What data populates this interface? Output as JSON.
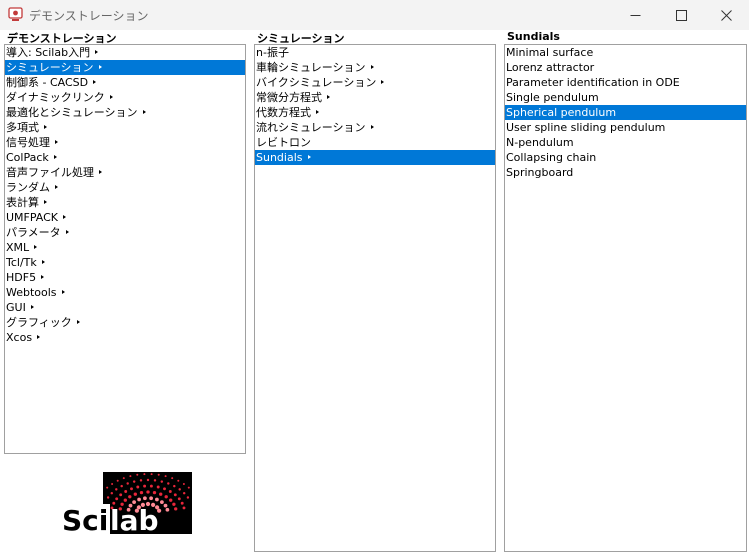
{
  "window": {
    "title": "デモンストレーション"
  },
  "columns": [
    {
      "title": "デモンストレーション",
      "items": [
        {
          "label": "導入: Scilab入門",
          "submenu": true
        },
        {
          "label": "シミュレーション",
          "submenu": true,
          "selected": true
        },
        {
          "label": "制御系 - CACSD",
          "submenu": true
        },
        {
          "label": "ダイナミックリンク",
          "submenu": true
        },
        {
          "label": "最適化とシミュレーション",
          "submenu": true
        },
        {
          "label": "多項式",
          "submenu": true
        },
        {
          "label": "信号処理",
          "submenu": true
        },
        {
          "label": "ColPack",
          "submenu": true
        },
        {
          "label": "音声ファイル処理",
          "submenu": true
        },
        {
          "label": "ランダム",
          "submenu": true
        },
        {
          "label": "表計算",
          "submenu": true
        },
        {
          "label": "UMFPACK",
          "submenu": true
        },
        {
          "label": "パラメータ",
          "submenu": true
        },
        {
          "label": "XML",
          "submenu": true
        },
        {
          "label": "Tcl/Tk",
          "submenu": true
        },
        {
          "label": "HDF5",
          "submenu": true
        },
        {
          "label": "Webtools",
          "submenu": true
        },
        {
          "label": "GUI",
          "submenu": true
        },
        {
          "label": "グラフィック",
          "submenu": true
        },
        {
          "label": "Xcos",
          "submenu": true
        }
      ]
    },
    {
      "title": "シミュレーション",
      "items": [
        {
          "label": "n-振子",
          "submenu": false
        },
        {
          "label": "車輪シミュレーション",
          "submenu": true
        },
        {
          "label": "バイクシミュレーション",
          "submenu": true
        },
        {
          "label": "常微分方程式",
          "submenu": true
        },
        {
          "label": "代数方程式",
          "submenu": true
        },
        {
          "label": "流れシミュレーション",
          "submenu": true
        },
        {
          "label": "レビトロン",
          "submenu": false
        },
        {
          "label": "Sundials",
          "submenu": true,
          "selected": true
        }
      ]
    },
    {
      "title": "Sundials",
      "items": [
        {
          "label": "Minimal surface",
          "submenu": false
        },
        {
          "label": "Lorenz attractor",
          "submenu": false
        },
        {
          "label": "Parameter identification in ODE",
          "submenu": false
        },
        {
          "label": "Single pendulum",
          "submenu": false
        },
        {
          "label": "Spherical pendulum",
          "submenu": false,
          "selected": true
        },
        {
          "label": "User spline sliding pendulum",
          "submenu": false
        },
        {
          "label": "N-pendulum",
          "submenu": false
        },
        {
          "label": "Collapsing chain",
          "submenu": false
        },
        {
          "label": "Springboard",
          "submenu": false
        }
      ]
    }
  ],
  "logo": {
    "text_sci": "Sci",
    "text_lab": "lab",
    "dot_color": "#e8263a"
  },
  "colors": {
    "selection": "#0078d7",
    "titlebar": "#f3f3f3"
  }
}
